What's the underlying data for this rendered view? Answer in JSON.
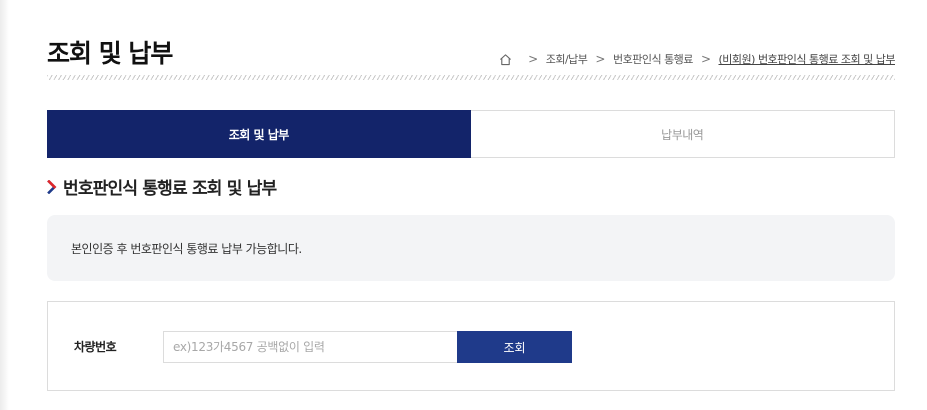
{
  "page": {
    "title": "조회 및 납부"
  },
  "breadcrumb": {
    "items": [
      "조회/납부",
      "번호판인식 통행료"
    ],
    "current": "(비회원) 번호판인식 통행료 조회 및 납부"
  },
  "tabs": [
    {
      "label": "조회 및 납부",
      "active": true
    },
    {
      "label": "납부내역",
      "active": false
    }
  ],
  "section": {
    "title": "번호판인식 통행료 조회 및 납부"
  },
  "notice": {
    "text": "본인인증 후 번호판인식 통행료 납부 가능합니다."
  },
  "form": {
    "label": "차량번호",
    "placeholder": "ex)123가4567 공백없이 입력",
    "value": "",
    "button_label": "조회"
  },
  "colors": {
    "primary": "#13246a",
    "button": "#1f3a8a",
    "chevron_red": "#e0262a",
    "chevron_blue": "#1f3a8a"
  },
  "icons": {
    "home": "home-icon",
    "separator": "chevron-right-icon",
    "section_marker": "chevron-right-icon"
  }
}
